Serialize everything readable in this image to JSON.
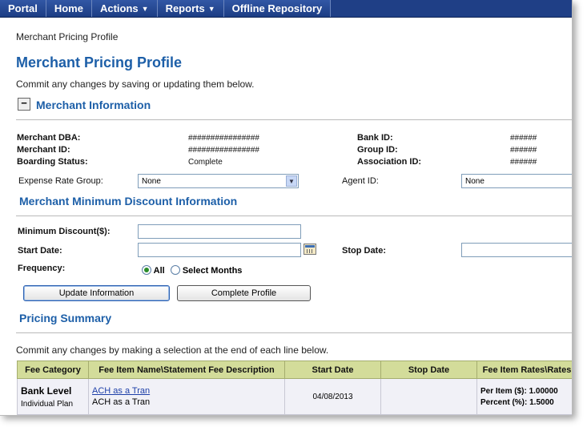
{
  "nav": {
    "items": [
      {
        "label": "Portal",
        "has_caret": false
      },
      {
        "label": "Home",
        "has_caret": false
      },
      {
        "label": "Actions",
        "has_caret": true
      },
      {
        "label": "Reports",
        "has_caret": true
      },
      {
        "label": "Offline Repository",
        "has_caret": false
      }
    ]
  },
  "breadcrumb": "Merchant Pricing Profile",
  "page_title": "Merchant Pricing Profile",
  "subtitle": "Commit any changes by saving or updating them below.",
  "merchant_info": {
    "toggle": "−",
    "heading": "Merchant Information",
    "dba_label": "Merchant DBA:",
    "dba_value": "################",
    "id_label": "Merchant ID:",
    "id_value": "################",
    "boarding_label": "Boarding Status:",
    "boarding_value": "Complete",
    "bank_label": "Bank ID:",
    "bank_value": "######",
    "group_label": "Group ID:",
    "group_value": "######",
    "assoc_label": "Association ID:",
    "assoc_value": "######",
    "expense_label": "Expense Rate Group:",
    "expense_value": "None",
    "agent_label": "Agent ID:",
    "agent_value": "None"
  },
  "min_discount": {
    "heading": "Merchant Minimum Discount Information",
    "min_label": "Minimum Discount($):",
    "min_value": "",
    "start_label": "Start Date:",
    "start_value": "",
    "stop_label": "Stop Date:",
    "stop_value": "",
    "freq_label": "Frequency:",
    "radio_all": "All",
    "radio_select": "Select Months",
    "selected_frequency": "All"
  },
  "buttons": {
    "update": "Update Information",
    "complete": "Complete Profile"
  },
  "pricing": {
    "heading": "Pricing Summary",
    "note": "Commit any changes by making a selection at the end of each line below.",
    "columns": [
      "Fee Category",
      "Fee Item Name\\Statement Fee Description",
      "Start Date",
      "Stop Date",
      "Fee Item Rates\\Rates"
    ],
    "rows": [
      {
        "category": "Bank Level",
        "category_sub": "Individual Plan",
        "fee_link": "ACH as a Tran",
        "fee_desc": "ACH as a Tran",
        "start": "04/08/2013",
        "stop": "",
        "rate1": "Per Item ($): 1.00000",
        "rate2": "Percent (%): 1.5000"
      }
    ]
  },
  "colors": {
    "nav_bg": "#1f3f86",
    "accent": "#1d5fa8",
    "table_header": "#d3dc9a"
  }
}
